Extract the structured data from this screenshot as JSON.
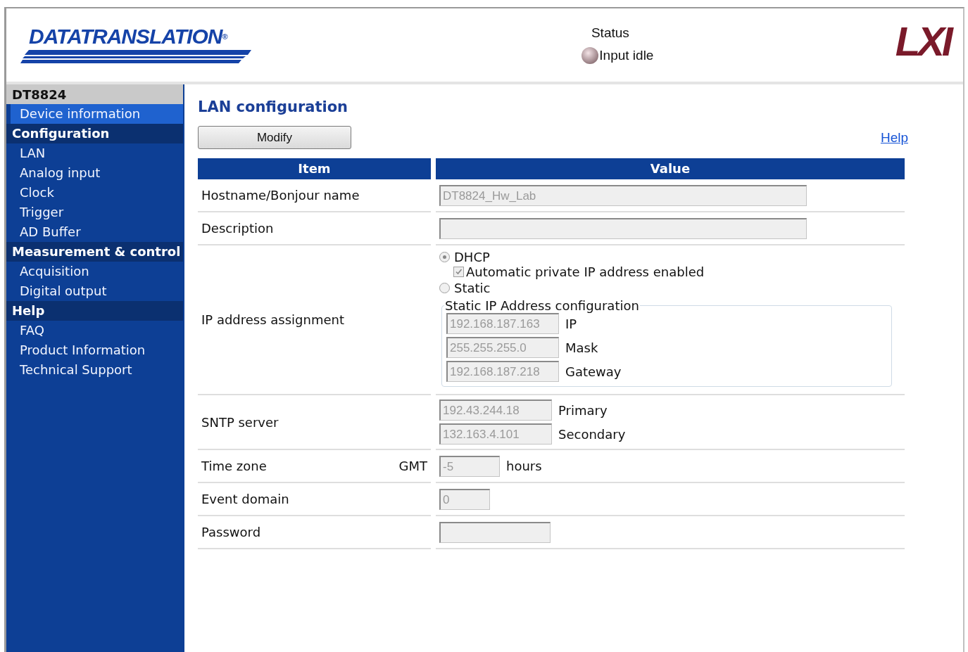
{
  "header": {
    "logo": {
      "name": "DATATRANSLATION",
      "mark": "®"
    },
    "status": {
      "label": "Status",
      "text": "Input idle"
    },
    "lxi_logo": "LXI"
  },
  "sidebar": {
    "title": "DT8824",
    "sections": [
      {
        "kind": "item",
        "label": "Device information",
        "selected": true
      },
      {
        "kind": "section",
        "label": "Configuration"
      },
      {
        "kind": "item",
        "label": "LAN",
        "selected": false
      },
      {
        "kind": "item",
        "label": "Analog input",
        "selected": false
      },
      {
        "kind": "item",
        "label": "Clock",
        "selected": false
      },
      {
        "kind": "item",
        "label": "Trigger",
        "selected": false
      },
      {
        "kind": "item",
        "label": "AD Buffer",
        "selected": false
      },
      {
        "kind": "section",
        "label": "Measurement & control"
      },
      {
        "kind": "item",
        "label": "Acquisition",
        "selected": false
      },
      {
        "kind": "item",
        "label": "Digital output",
        "selected": false
      },
      {
        "kind": "section",
        "label": "Help"
      },
      {
        "kind": "item",
        "label": "FAQ",
        "selected": false
      },
      {
        "kind": "item",
        "label": "Product Information",
        "selected": false
      },
      {
        "kind": "item",
        "label": "Technical Support",
        "selected": false
      }
    ]
  },
  "main": {
    "title": "LAN configuration",
    "modify_button": "Modify",
    "help_link": "Help",
    "table": {
      "columns": [
        "Item",
        "Value"
      ],
      "rows": [
        {
          "kind": "long-field",
          "item": "Hostname/Bonjour name",
          "value": "DT8824_Hw_Lab"
        },
        {
          "kind": "long-field",
          "item": "Description"
        },
        {
          "kind": "ip",
          "item": "IP address assignment",
          "dhcp": {
            "label": "DHCP",
            "selected": true
          },
          "auto_private": {
            "label": "Automatic private IP address enabled",
            "checked": true
          },
          "static": {
            "label": "Static",
            "selected": false
          },
          "static_config": {
            "legend": "Static IP Address configuration",
            "fields": [
              {
                "value": "192.168.187.163",
                "label": "IP"
              },
              {
                "value": "255.255.255.0",
                "label": "Mask"
              },
              {
                "value": "192.168.187.218",
                "label": "Gateway"
              }
            ]
          }
        },
        {
          "kind": "pairs",
          "item": "SNTP server",
          "fields": [
            {
              "value": "192.43.244.18",
              "label": "Primary"
            },
            {
              "value": "132.163.4.101",
              "label": "Secondary"
            }
          ]
        },
        {
          "kind": "timezone",
          "item": "Time zone",
          "prefix": "GMT",
          "value": "-5",
          "unit": "hours"
        },
        {
          "kind": "short-field",
          "item": "Event domain",
          "value": "0"
        },
        {
          "kind": "medium-field",
          "item": "Password"
        }
      ]
    }
  }
}
